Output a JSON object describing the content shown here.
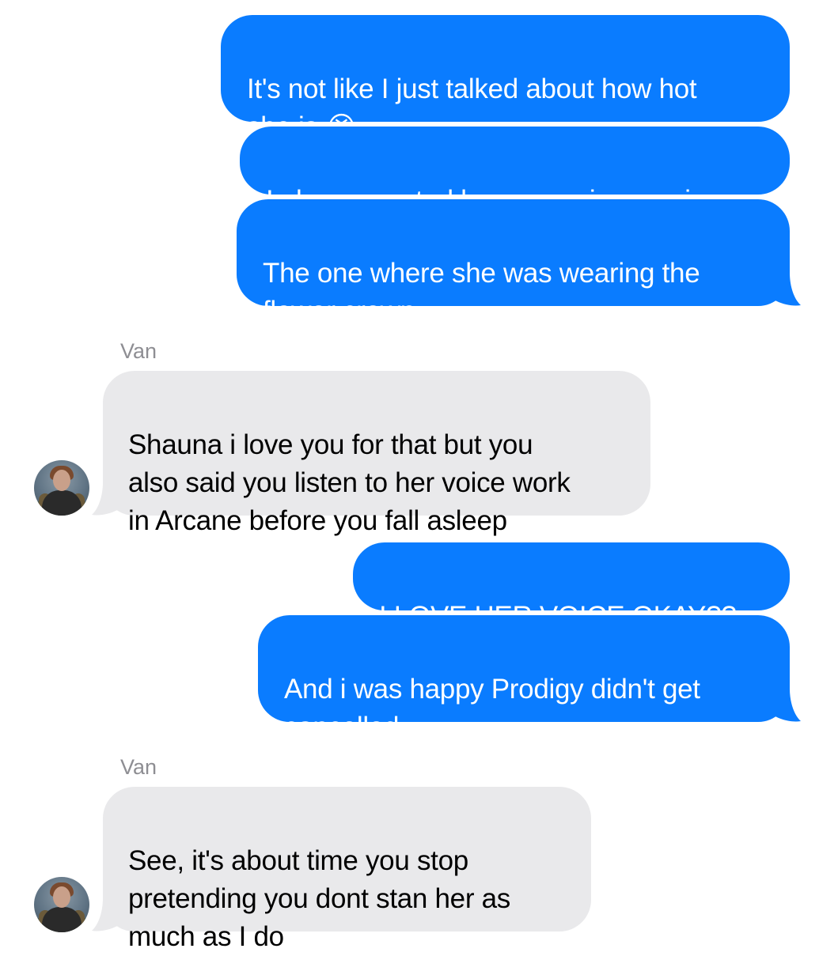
{
  "conversation": {
    "contact_name": "Van",
    "colors": {
      "sent_bubble": "#0a7cff",
      "received_bubble": "#e9e9eb",
      "sender_name": "#8e8e93"
    },
    "messages": [
      {
        "direction": "outgoing",
        "text": "It's not like I just talked about how hot\nshe is 😭"
      },
      {
        "direction": "outgoing",
        "text": "I also promoted her upcoming movie"
      },
      {
        "direction": "outgoing",
        "text": "The one where she was wearing the\nflower crown"
      },
      {
        "direction": "incoming",
        "sender": "Van",
        "text": "Shauna i love you for that but you\nalso said you listen to her voice work\nin Arcane before you fall asleep"
      },
      {
        "direction": "outgoing",
        "text": "I LOVE HER VOICE OKAY??"
      },
      {
        "direction": "outgoing",
        "text": "And i was happy Prodigy didn't get\ncancelled"
      },
      {
        "direction": "incoming",
        "sender": "Van",
        "text": "See, it's about time you stop\npretending you dont stan her as\nmuch as I do"
      }
    ]
  }
}
